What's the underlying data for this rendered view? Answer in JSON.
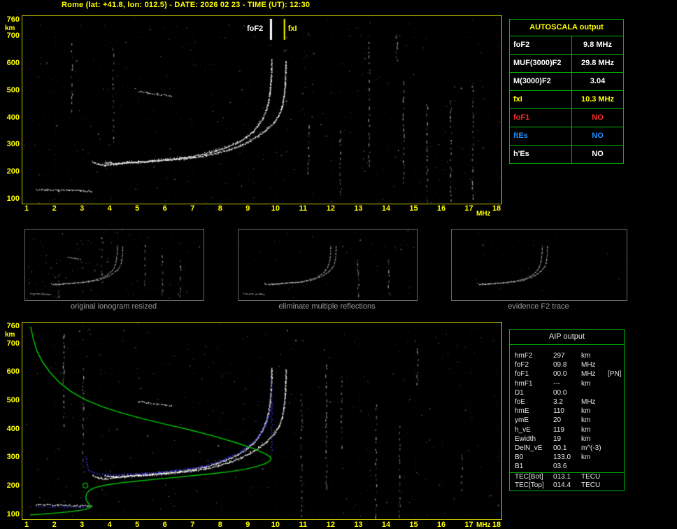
{
  "header": {
    "title": "Rome (lat: +41.8, lon: 012.5) - DATE: 2026 02 23 - TIME (UT): 12:30"
  },
  "colors": {
    "background": "#000000",
    "accent_yellow": "#ffff00",
    "table_green": "#00b400",
    "trace_white": "#ffffff",
    "restored_blue": "#3a3aff",
    "profile_green": "#00cc00",
    "status_red": "#ff2a2a",
    "status_blue": "#1e90ff",
    "caption_gray": "#9a9a9a"
  },
  "chart_data": {
    "type": "scatter",
    "x_axis": {
      "unit": "MHz",
      "ticks": [
        1,
        2,
        3,
        4,
        5,
        6,
        7,
        8,
        9,
        10,
        11,
        12,
        13,
        14,
        15,
        16,
        17,
        18
      ],
      "range": [
        0.82,
        18.15
      ]
    },
    "y_axis": {
      "unit": "km",
      "ticks": [
        760,
        700,
        600,
        500,
        400,
        300,
        200,
        100
      ],
      "range": [
        85,
        775
      ]
    },
    "markers": {
      "foF2": {
        "label": "foF2",
        "MHz": 9.8
      },
      "fxI": {
        "label": "fxI",
        "MHz": 10.3
      }
    },
    "traces": {
      "es_layer": [
        [
          1.3,
          138
        ],
        [
          1.7,
          137
        ],
        [
          2.1,
          136
        ],
        [
          2.5,
          135
        ],
        [
          2.9,
          134
        ],
        [
          3.15,
          133
        ],
        [
          3.3,
          132
        ]
      ],
      "f2_ordinary": [
        [
          3.35,
          240
        ],
        [
          3.55,
          231
        ],
        [
          3.8,
          228
        ],
        [
          4.1,
          232
        ],
        [
          4.5,
          237
        ],
        [
          5.0,
          241
        ],
        [
          5.5,
          245
        ],
        [
          6.0,
          249
        ],
        [
          6.5,
          254
        ],
        [
          7.0,
          261
        ],
        [
          7.4,
          270
        ],
        [
          7.8,
          281
        ],
        [
          8.2,
          295
        ],
        [
          8.6,
          313
        ],
        [
          8.9,
          331
        ],
        [
          9.15,
          352
        ],
        [
          9.35,
          376
        ],
        [
          9.5,
          400
        ],
        [
          9.62,
          428
        ],
        [
          9.7,
          458
        ],
        [
          9.76,
          495
        ],
        [
          9.8,
          540
        ],
        [
          9.82,
          585
        ],
        [
          9.83,
          615
        ]
      ],
      "f2_extraordinary": [
        [
          3.8,
          238
        ],
        [
          4.2,
          234
        ],
        [
          4.6,
          237
        ],
        [
          5.0,
          240
        ],
        [
          5.5,
          243
        ],
        [
          6.0,
          247
        ],
        [
          6.5,
          251
        ],
        [
          7.0,
          257
        ],
        [
          7.45,
          264
        ],
        [
          7.9,
          274
        ],
        [
          8.3,
          286
        ],
        [
          8.7,
          301
        ],
        [
          9.05,
          318
        ],
        [
          9.35,
          337
        ],
        [
          9.65,
          360
        ],
        [
          9.9,
          385
        ],
        [
          10.08,
          412
        ],
        [
          10.2,
          443
        ],
        [
          10.27,
          480
        ],
        [
          10.31,
          525
        ],
        [
          10.33,
          572
        ],
        [
          10.34,
          610
        ]
      ],
      "f2_second_hop": [
        [
          5.0,
          500
        ],
        [
          5.35,
          494
        ],
        [
          5.7,
          489
        ],
        [
          6.0,
          486
        ],
        [
          6.2,
          484
        ]
      ]
    },
    "restored_trace": {
      "main": [
        [
          3.1,
          305
        ],
        [
          3.14,
          278
        ],
        [
          3.2,
          258
        ],
        [
          3.4,
          250
        ],
        [
          3.8,
          244
        ],
        [
          4.3,
          243
        ],
        [
          4.8,
          245
        ],
        [
          5.3,
          248
        ],
        [
          5.8,
          252
        ],
        [
          6.3,
          257
        ],
        [
          6.8,
          263
        ],
        [
          7.3,
          272
        ],
        [
          7.7,
          283
        ],
        [
          8.1,
          296
        ],
        [
          8.5,
          314
        ],
        [
          8.85,
          334
        ],
        [
          9.15,
          357
        ],
        [
          9.4,
          383
        ],
        [
          9.58,
          412
        ],
        [
          9.7,
          445
        ],
        [
          9.78,
          480
        ]
      ],
      "asymptote": [
        [
          9.82,
          330
        ],
        [
          9.82,
          575
        ]
      ],
      "es": [
        [
          1.4,
          131
        ],
        [
          1.9,
          130
        ],
        [
          2.4,
          129
        ],
        [
          2.9,
          128
        ],
        [
          3.1,
          128
        ]
      ]
    },
    "profile": {
      "points": [
        [
          1.12,
          760
        ],
        [
          1.22,
          715
        ],
        [
          1.36,
          672
        ],
        [
          1.56,
          635
        ],
        [
          1.82,
          600
        ],
        [
          2.15,
          566
        ],
        [
          2.58,
          533
        ],
        [
          3.08,
          505
        ],
        [
          3.7,
          480
        ],
        [
          4.4,
          458
        ],
        [
          5.2,
          437
        ],
        [
          6.0,
          418
        ],
        [
          6.9,
          398
        ],
        [
          7.8,
          375
        ],
        [
          8.6,
          352
        ],
        [
          9.2,
          332
        ],
        [
          9.6,
          315
        ],
        [
          9.78,
          304
        ],
        [
          9.82,
          297
        ],
        [
          9.78,
          290
        ],
        [
          9.6,
          280
        ],
        [
          9.3,
          270
        ],
        [
          8.9,
          261
        ],
        [
          8.4,
          253
        ],
        [
          7.8,
          246
        ],
        [
          7.1,
          239
        ],
        [
          6.4,
          232
        ],
        [
          5.7,
          226
        ],
        [
          5.0,
          219
        ],
        [
          4.4,
          213
        ],
        [
          3.9,
          206
        ],
        [
          3.55,
          199
        ],
        [
          3.35,
          192
        ],
        [
          3.22,
          184
        ],
        [
          3.15,
          175
        ],
        [
          3.12,
          166
        ],
        [
          3.12,
          156
        ],
        [
          3.16,
          147
        ],
        [
          3.22,
          139
        ],
        [
          3.3,
          132
        ],
        [
          3.28,
          126
        ],
        [
          3.15,
          121
        ],
        [
          2.9,
          116
        ],
        [
          2.6,
          112
        ],
        [
          2.2,
          108
        ],
        [
          1.8,
          105
        ],
        [
          1.4,
          102
        ],
        [
          1.1,
          100
        ]
      ],
      "marker": {
        "MHz": 3.1,
        "km": 203
      }
    }
  },
  "autoscala": {
    "title": "AUTOSCALA output",
    "rows": [
      {
        "label": "foF2",
        "value": "9.8 MHz",
        "color": "#ffffff"
      },
      {
        "label": "MUF(3000)F2",
        "value": "29.8 MHz",
        "color": "#ffffff"
      },
      {
        "label": "M(3000)F2",
        "value": "3.04",
        "color": "#ffffff"
      },
      {
        "label": "fxI",
        "value": "10.3 MHz",
        "color": "#ffff00"
      },
      {
        "label": "foF1",
        "value": "NO",
        "color": "#ff2a2a"
      },
      {
        "label": "ftEs",
        "value": "NO",
        "color": "#1e90ff"
      },
      {
        "label": "h'Es",
        "value": "NO",
        "color": "#ffffff"
      }
    ]
  },
  "thumbnails": [
    {
      "caption": "original ionogram resized"
    },
    {
      "caption": "eliminate multiple reflections"
    },
    {
      "caption": "evidence F2 trace"
    }
  ],
  "aip": {
    "title": "AIP output",
    "rows": [
      {
        "label": "hmF2",
        "value": "297",
        "unit": "km",
        "note": ""
      },
      {
        "label": "foF2",
        "value": "09.8",
        "unit": "MHz",
        "note": ""
      },
      {
        "label": "foF1",
        "value": "00.0",
        "unit": "MHz",
        "note": "[PN]"
      },
      {
        "label": "hmF1",
        "value": "---",
        "unit": "km",
        "note": ""
      },
      {
        "label": "D1",
        "value": "00.0",
        "unit": "",
        "note": ""
      },
      {
        "label": "foE",
        "value": "3.2",
        "unit": "MHz",
        "note": ""
      },
      {
        "label": "hmE",
        "value": "110",
        "unit": "km",
        "note": ""
      },
      {
        "label": "ymE",
        "value": "20",
        "unit": "km",
        "note": ""
      },
      {
        "label": "h_vE",
        "value": "119",
        "unit": "km",
        "note": ""
      },
      {
        "label": "Ewidth",
        "value": "19",
        "unit": "km",
        "note": ""
      },
      {
        "label": "DelN_vE",
        "value": "00.1",
        "unit": "m^(-3)",
        "note": ""
      },
      {
        "label": "B0",
        "value": "133.0",
        "unit": "km",
        "note": ""
      },
      {
        "label": "B1",
        "value": "03.6",
        "unit": "",
        "note": ""
      }
    ],
    "tec_rows": [
      {
        "label": "TEC[Bot]",
        "value": "013.1",
        "unit": "TECU"
      },
      {
        "label": "TEC[Top]",
        "value": "014.4",
        "unit": "TECU"
      }
    ]
  }
}
